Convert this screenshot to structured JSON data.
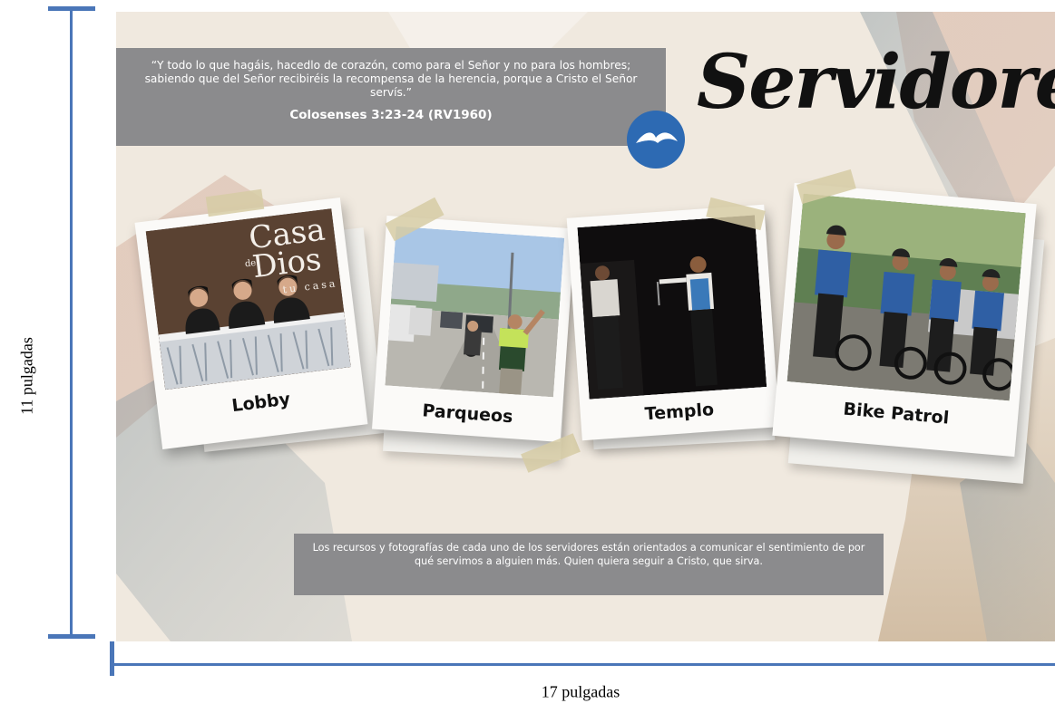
{
  "dimensions": {
    "height_label": "11 pulgadas",
    "width_label": "17 pulgadas"
  },
  "poster": {
    "quote": "“Y todo lo que hagáis, hacedlo de corazón, como para el Señor y no para los hombres; sabiendo que del Señor recibiréis la recompensa de la herencia, porque a Cristo el Señor servís.”",
    "quote_reference": "Colosenses 3:23-24 (RV1960)",
    "title": "Servidores",
    "cards": [
      {
        "caption": "Lobby",
        "sign_line1": "Casa",
        "sign_small": "de",
        "sign_line2": "Dios",
        "sign_line3": "tu casa"
      },
      {
        "caption": "Parqueos"
      },
      {
        "caption": "Templo"
      },
      {
        "caption": "Bike Patrol"
      }
    ],
    "footer_text": "Los recursos y fotografías de cada uno de los servidores están orientados a comunicar el sentimiento de por qué servimos a alguien más. Quien quiera seguir a Cristo, que sirva.",
    "colors": {
      "dimension_line": "#4a76b8",
      "text_box": "#8b8b8d",
      "logo": "#2d6ab3",
      "title": "#111111"
    }
  }
}
